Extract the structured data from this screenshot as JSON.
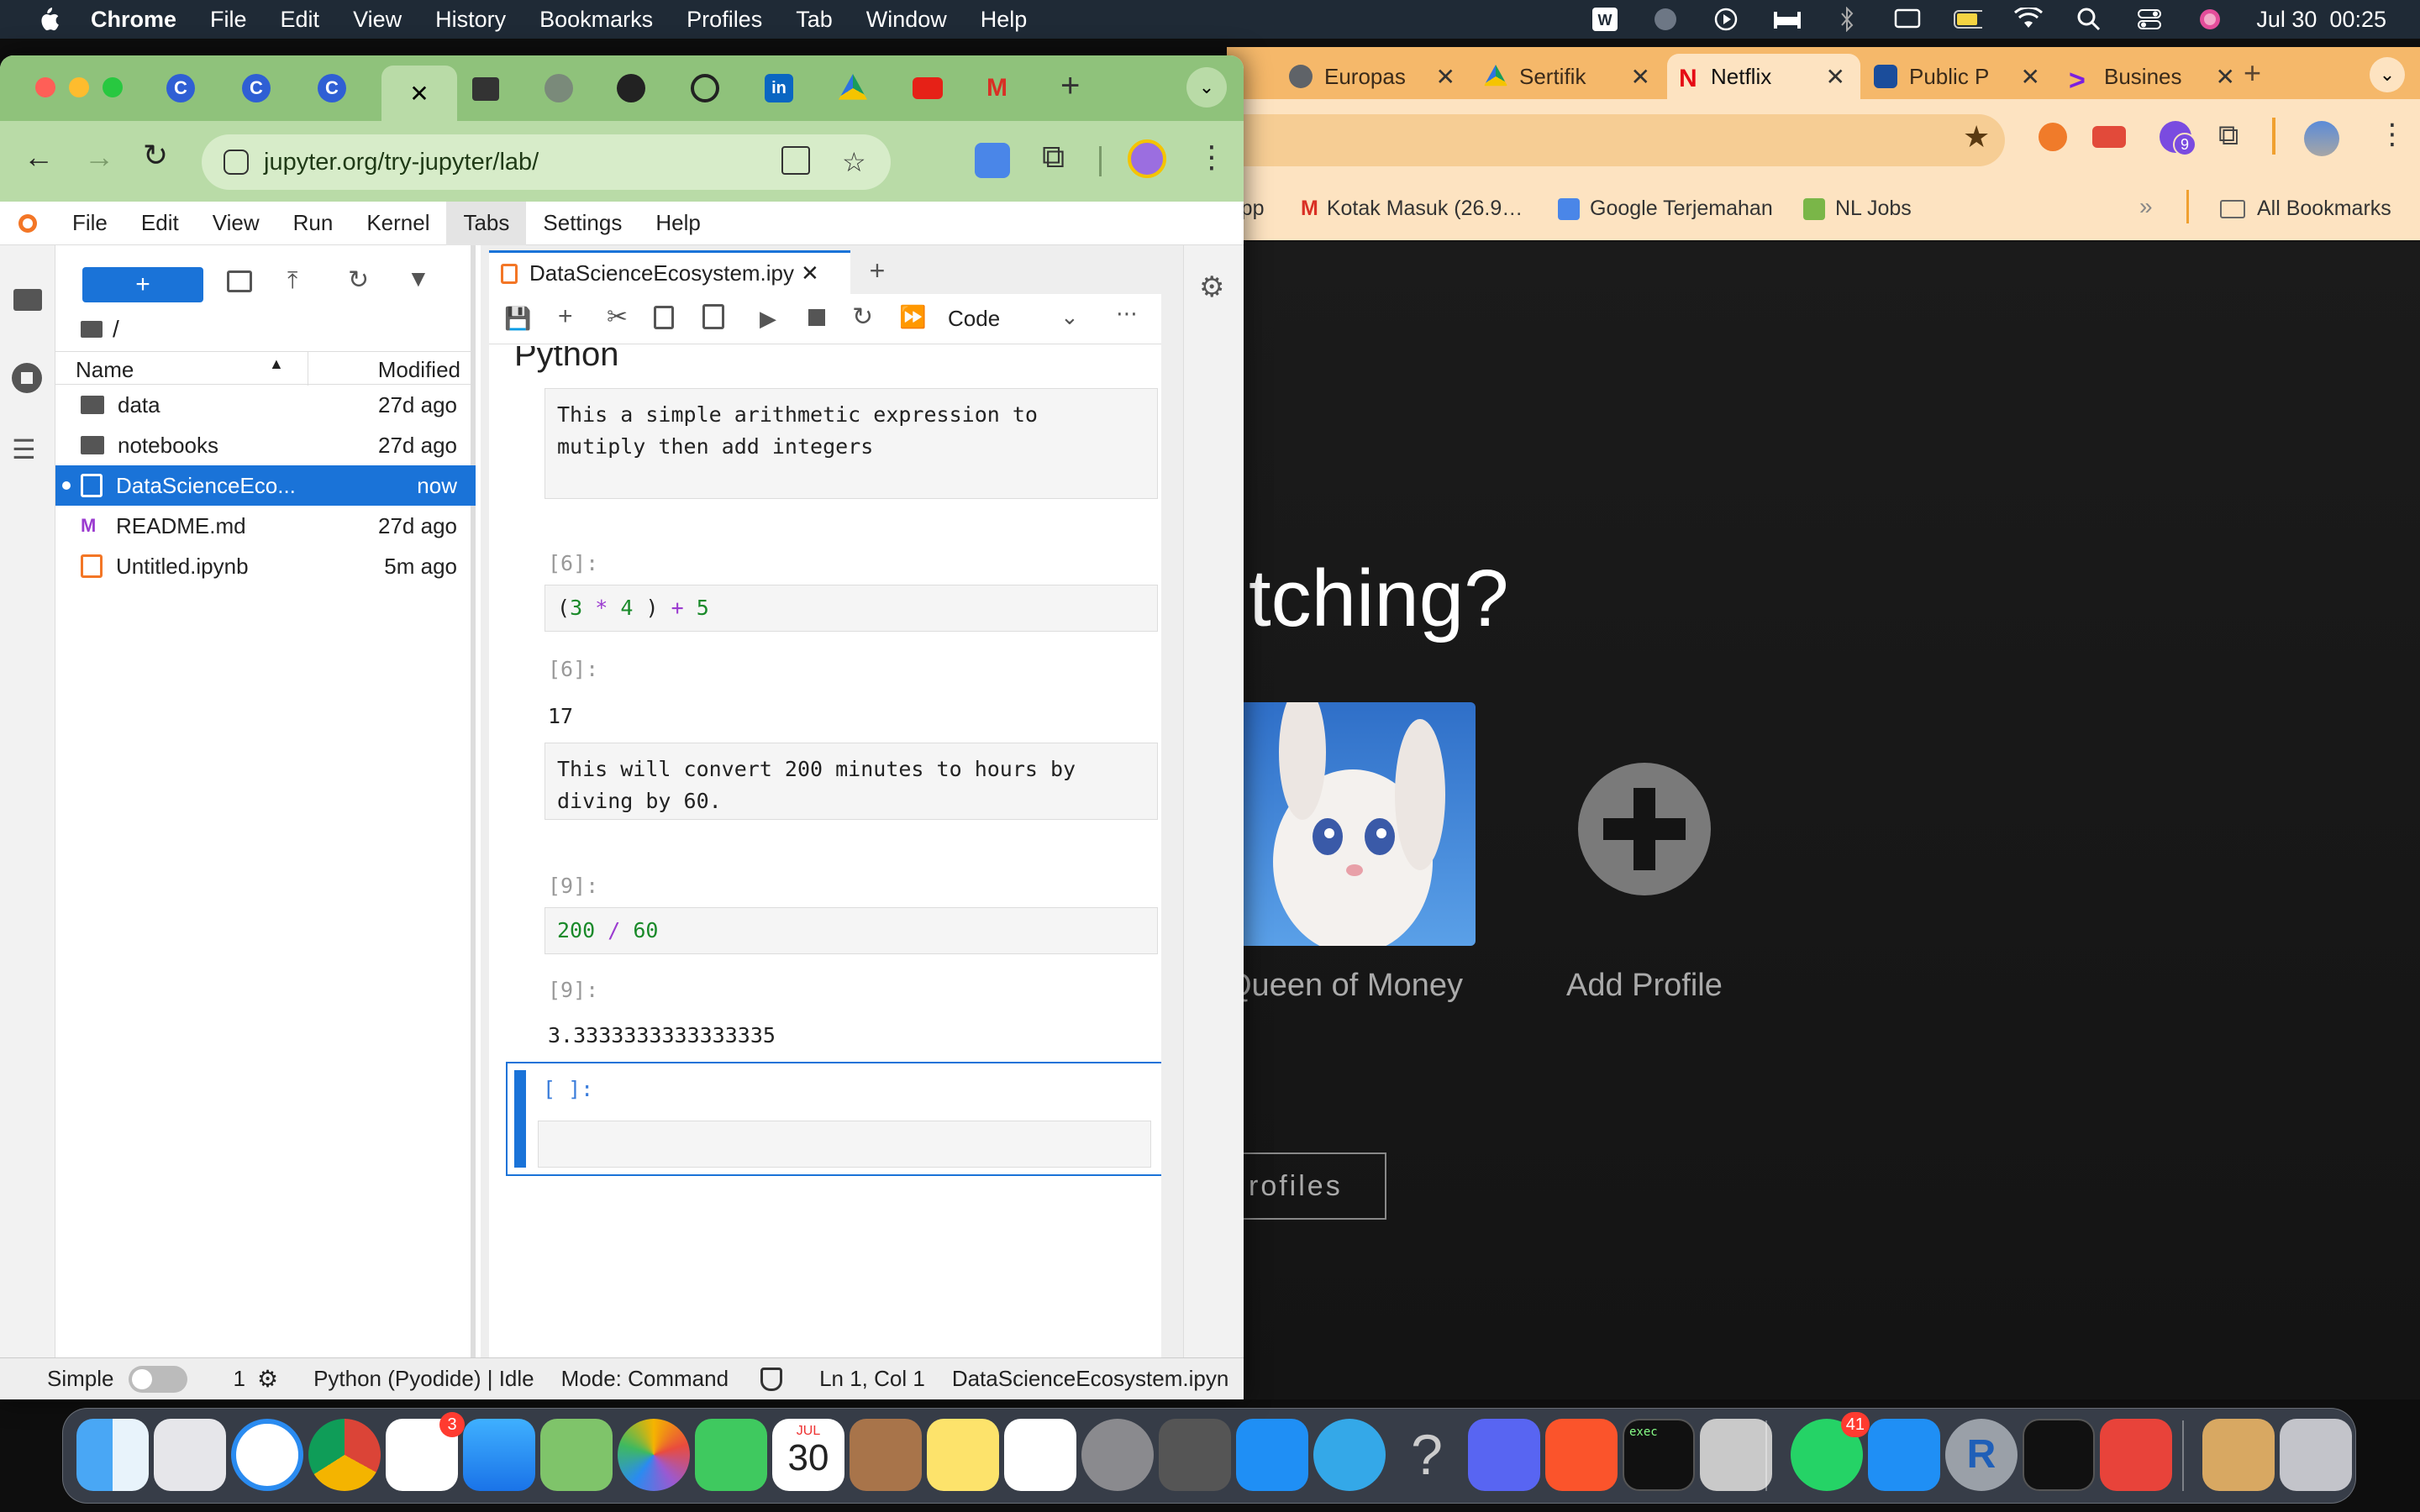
{
  "menubar": {
    "app": "Chrome",
    "items": [
      "File",
      "Edit",
      "View",
      "History",
      "Bookmarks",
      "Profiles",
      "Tab",
      "Window",
      "Help"
    ],
    "clock": "Jul 30  00:25"
  },
  "bg_browser": {
    "tabs": [
      {
        "label": "Europas",
        "color": "#5f6368"
      },
      {
        "label": "Sertifik",
        "color": "#1a9c5b"
      },
      {
        "label": "Netflix",
        "color": "#e50914"
      },
      {
        "label": "Public P",
        "color": "#1b4d9b"
      },
      {
        "label": "Busines",
        "color": "#7b1fe0"
      }
    ],
    "bookmarks": [
      "App",
      "Kotak Masuk (26.9…",
      "Google Terjemahan",
      "NL Jobs"
    ],
    "all_bookmarks": "All Bookmarks",
    "extension_badge": "9",
    "netflix": {
      "heading": "tching?",
      "profile_name": "Queen of Money",
      "add_profile": "Add Profile",
      "manage": "rofiles"
    }
  },
  "jupyter_browser": {
    "url": "jupyter.org/try-jupyter/lab/",
    "menu": [
      "File",
      "Edit",
      "View",
      "Run",
      "Kernel",
      "Tabs",
      "Settings",
      "Help"
    ],
    "active_menu": "Tabs",
    "filebrowser": {
      "path": "/",
      "col_name": "Name",
      "col_modified": "Modified",
      "rows": [
        {
          "name": "data",
          "modified": "27d ago",
          "kind": "folder"
        },
        {
          "name": "notebooks",
          "modified": "27d ago",
          "kind": "folder"
        },
        {
          "name": "DataScienceEco...",
          "modified": "now",
          "kind": "notebook"
        },
        {
          "name": "README.md",
          "modified": "27d ago",
          "kind": "markdown"
        },
        {
          "name": "Untitled.ipynb",
          "modified": "5m ago",
          "kind": "notebook"
        }
      ]
    },
    "notebook": {
      "tab_title": "DataScienceEcosystem.ipy",
      "cell_type": "Code",
      "partial_heading": "Python",
      "md1": "This a simple arithmetic expression to\nmutiply then add integers",
      "in6_prompt": "[6]:",
      "out6_prompt": "[6]:",
      "out6": "17",
      "md2": "This will convert 200 minutes to hours by\ndiving by 60.",
      "in9_prompt": "[9]:",
      "out9_prompt": "[9]:",
      "out9": "3.3333333333333335",
      "empty_prompt": "[ ]:"
    },
    "status": {
      "mode_label": "Simple",
      "terminals": "1",
      "kernel": "Python (Pyodide) | Idle",
      "mode": "Mode: Command",
      "cursor": "Ln 1, Col 1",
      "file": "DataScienceEcosystem.ipyn"
    }
  },
  "dock": {
    "reminders_badge": "3",
    "calendar_month": "JUL",
    "calendar_day": "30",
    "whatsapp_badge": "41",
    "terminal_label": "exec"
  }
}
